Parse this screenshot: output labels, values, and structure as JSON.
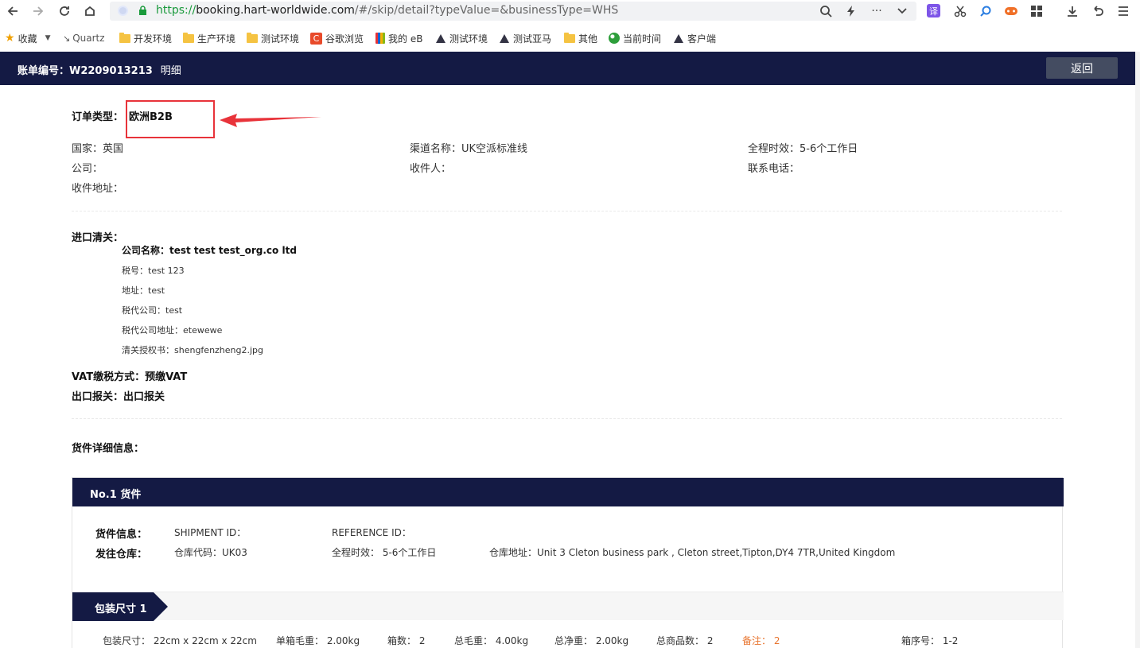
{
  "browser": {
    "url_proto": "https://",
    "url_host": "booking.hart-worldwide.com",
    "url_path": "/#/skip/detail?typeValue=&businessType=WHS",
    "ext_translate": "译",
    "bookmarks": [
      {
        "label": "收藏",
        "kind": "star"
      },
      {
        "label": "Quartz",
        "kind": "text"
      },
      {
        "label": "开发环境",
        "kind": "folder"
      },
      {
        "label": "生产环境",
        "kind": "folder"
      },
      {
        "label": "测试环境",
        "kind": "folder"
      },
      {
        "label": "谷歌浏览",
        "kind": "c"
      },
      {
        "label": "我的 eB",
        "kind": "bag"
      },
      {
        "label": "测试环境",
        "kind": "hart"
      },
      {
        "label": "测试亚马",
        "kind": "hart"
      },
      {
        "label": "其他",
        "kind": "folder"
      },
      {
        "label": "当前时间",
        "kind": "ball"
      },
      {
        "label": "客户端",
        "kind": "hart"
      }
    ]
  },
  "header": {
    "title": "账单编号：W2209013213",
    "subtitle": "明细",
    "back_label": "返回"
  },
  "order": {
    "type_label": "订单类型：",
    "type_value": "欧洲B2B",
    "country": "国家：英国",
    "channel": "渠道名称：UK空派标准线",
    "eta": "全程时效：5-6个工作日",
    "company": "公司：",
    "receiver": "收件人：",
    "phone": "联系电话：",
    "address": "收件地址："
  },
  "customs": {
    "title": "进口清关：",
    "company_name": "公司名称：test test test_org.co ltd",
    "tax_no": "税号：test 123",
    "addr": "地址：test",
    "tax_agent": "税代公司：test",
    "tax_agent_addr": "税代公司地址：etewewe",
    "auth_letter": "清关授权书：shengfenzheng2.jpg",
    "vat": "VAT缴税方式：预缴VAT",
    "export": "出口报关：出口报关"
  },
  "goods": {
    "section_title": "货件详细信息：",
    "panel_title": "No.1 货件",
    "info_label": "货件信息：",
    "shipment_id": "SHIPMENT ID：",
    "reference_id": "REFERENCE ID：",
    "warehouse_label": "发往仓库：",
    "warehouse_code": "仓库代码：UK03",
    "warehouse_eta": "全程时效：  5-6个工作日",
    "warehouse_addr": "仓库地址：Unit 3 Cleton business park , Cleton street,Tipton,DY4 7TR,United Kingdom",
    "pkg_tab": "包装尺寸 1",
    "pkg_size": "包装尺寸：  22cm x 22cm x 22cm",
    "box_weight": "单箱毛重：  2.00kg",
    "box_count": "箱数：  2",
    "gross_weight": "总毛重：  4.00kg",
    "net_weight": "总净重：  2.00kg",
    "total_items": "总商品数：  2",
    "remark": "备注：  2",
    "box_no": "箱序号：  1-2"
  }
}
